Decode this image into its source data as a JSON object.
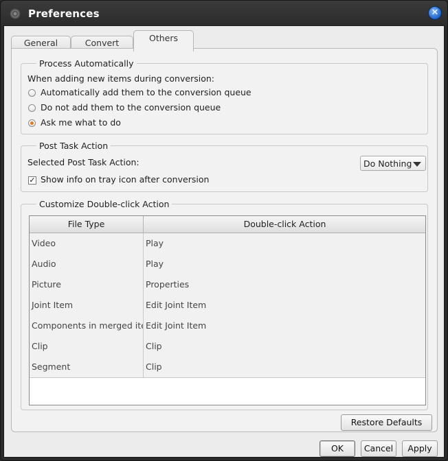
{
  "window": {
    "title": "Preferences"
  },
  "tabs": [
    {
      "label": "General"
    },
    {
      "label": "Convert"
    },
    {
      "label": "Others",
      "active": true
    }
  ],
  "process_auto": {
    "legend": "Process Automatically",
    "prompt": "When adding new items during conversion:",
    "options": [
      {
        "label": "Automatically add them to the conversion queue",
        "selected": false
      },
      {
        "label": "Do not add them to the conversion queue",
        "selected": false
      },
      {
        "label": "Ask me what to do",
        "selected": true
      }
    ]
  },
  "post_task": {
    "legend": "Post Task Action",
    "label": "Selected Post Task Action:",
    "selected_value": "Do Nothing",
    "tray_label": "Show info on tray icon after conversion",
    "tray_checked": true
  },
  "double_click": {
    "legend": "Customize Double-click Action",
    "columns": [
      "File Type",
      "Double-click Action"
    ],
    "rows": [
      [
        "Video",
        "Play"
      ],
      [
        "Audio",
        "Play"
      ],
      [
        "Picture",
        "Properties"
      ],
      [
        "Joint Item",
        "Edit Joint Item"
      ],
      [
        "Components in merged items",
        "Edit Joint Item"
      ],
      [
        "Clip",
        "Clip"
      ],
      [
        "Segment",
        "Clip"
      ]
    ]
  },
  "buttons": {
    "restore": "Restore Defaults",
    "ok": "OK",
    "cancel": "Cancel",
    "apply": "Apply"
  },
  "icons": {
    "close": "close-icon",
    "app": "app-icon"
  },
  "colors": {
    "radio_selected": "#e07b22",
    "close_button": "#1f62c9"
  }
}
